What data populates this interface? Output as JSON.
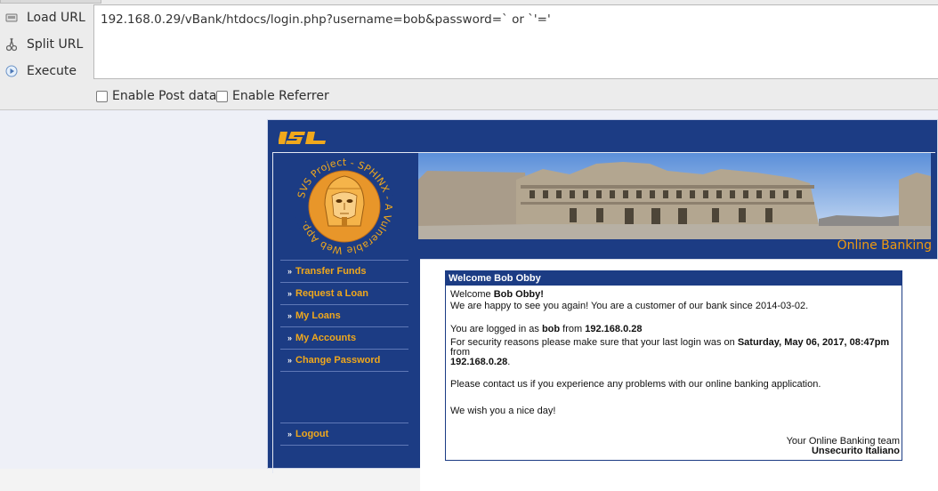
{
  "toolbar": {
    "load_url": "Load URL",
    "split_url": "Split URL",
    "execute": "Execute",
    "url_value": "192.168.0.29/vBank/htdocs/login.php?username=bob&password=` or `'='",
    "enable_post": "Enable Post data",
    "enable_referrer": "Enable Referrer"
  },
  "site": {
    "logo_text": "ISL",
    "emblem_text": "SVS Project - SPHINX - A Vulnerable Web App.",
    "online_banking": "Online Banking",
    "nav": [
      {
        "label": "Transfer Funds"
      },
      {
        "label": "Request a Loan"
      },
      {
        "label": "My Loans"
      },
      {
        "label": "My Accounts"
      },
      {
        "label": "Change Password"
      }
    ],
    "logout": "Logout"
  },
  "panel": {
    "title": "Welcome Bob Obby",
    "welcome_prefix": "Welcome ",
    "welcome_name": "Bob Obby!",
    "happy_line": "We are happy to see you again! You are a customer of our bank since 2014-03-02.",
    "logged_a": "You are logged in as ",
    "logged_user": "bob",
    "logged_b": " from ",
    "logged_ip": "192.168.0.28",
    "security_a": "For security reasons please make sure that your last login was on ",
    "security_date": "Saturday, May 06, 2017, 08:47pm",
    "security_b": " from",
    "security_ip": "192.168.0.28",
    "security_end": ".",
    "contact": "Please contact us if you experience any problems with our online banking application.",
    "nice_day": "We wish you a nice day!",
    "team": "Your Online Banking team",
    "company": "Unsecurito Italiano"
  },
  "colors": {
    "site_blue": "#1c3c84",
    "nav_orange": "#f0a81c",
    "label_orange": "#ee9a12"
  }
}
